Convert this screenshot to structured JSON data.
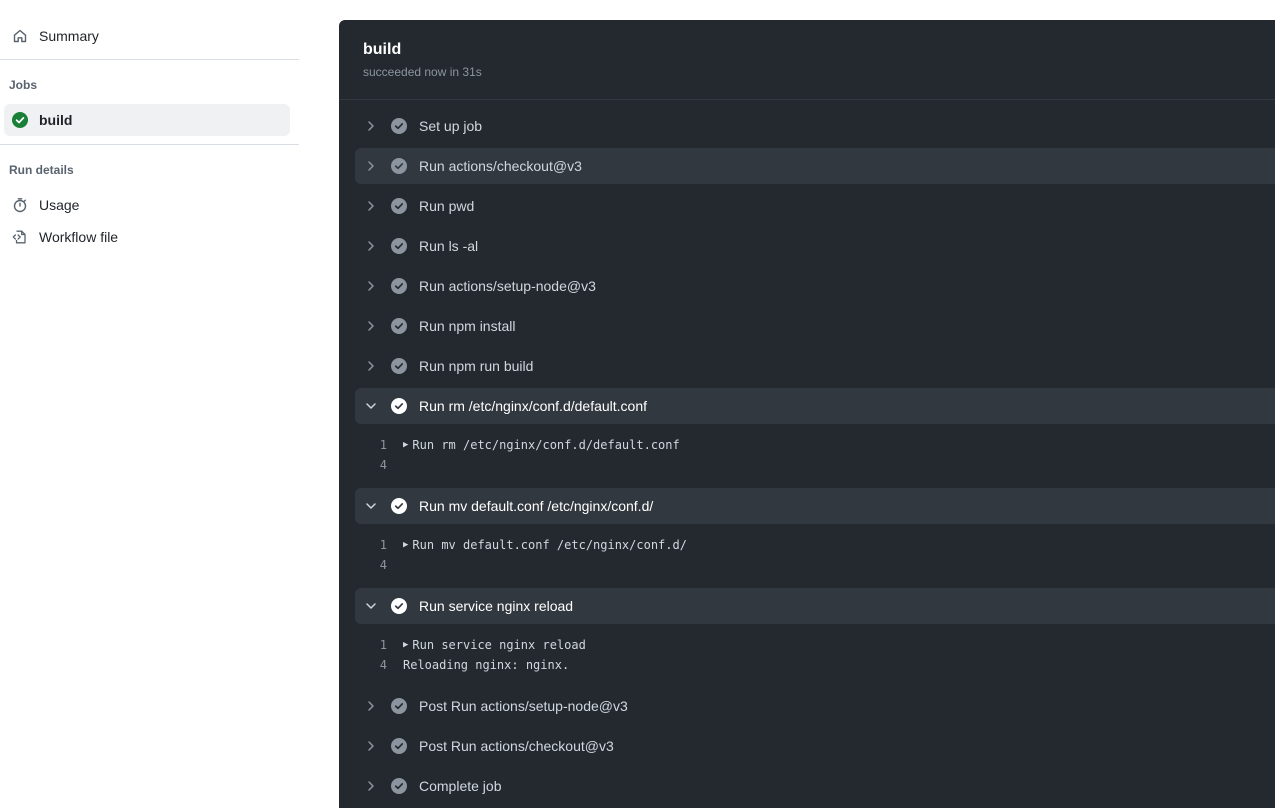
{
  "sidebar": {
    "summary_label": "Summary",
    "jobs_heading": "Jobs",
    "jobs": [
      {
        "label": "build",
        "status": "success"
      }
    ],
    "run_details_heading": "Run details",
    "details": [
      {
        "label": "Usage",
        "icon": "stopwatch-icon"
      },
      {
        "label": "Workflow file",
        "icon": "file-code-icon"
      }
    ]
  },
  "job": {
    "title": "build",
    "subtitle": "succeeded now in 31s"
  },
  "steps": [
    {
      "label": "Set up job"
    },
    {
      "label": "Run actions/checkout@v3"
    },
    {
      "label": "Run pwd"
    },
    {
      "label": "Run ls -al"
    },
    {
      "label": "Run actions/setup-node@v3"
    },
    {
      "label": "Run npm install"
    },
    {
      "label": "Run npm run build"
    },
    {
      "label": "Run rm /etc/nginx/conf.d/default.conf",
      "log": [
        {
          "num": "1",
          "text": "Run rm /etc/nginx/conf.d/default.conf"
        },
        {
          "num": "4",
          "text": ""
        }
      ]
    },
    {
      "label": "Run mv default.conf /etc/nginx/conf.d/",
      "log": [
        {
          "num": "1",
          "text": "Run mv default.conf /etc/nginx/conf.d/"
        },
        {
          "num": "4",
          "text": ""
        }
      ]
    },
    {
      "label": "Run service nginx reload",
      "log": [
        {
          "num": "1",
          "text": "Run service nginx reload"
        },
        {
          "num": "4",
          "text": "Reloading nginx: nginx."
        }
      ]
    },
    {
      "label": "Post Run actions/setup-node@v3"
    },
    {
      "label": "Post Run actions/checkout@v3"
    },
    {
      "label": "Complete job"
    }
  ],
  "colors": {
    "success_green": "#1a7f37",
    "panel_bg": "#24292f",
    "step_highlight": "#32383f"
  }
}
